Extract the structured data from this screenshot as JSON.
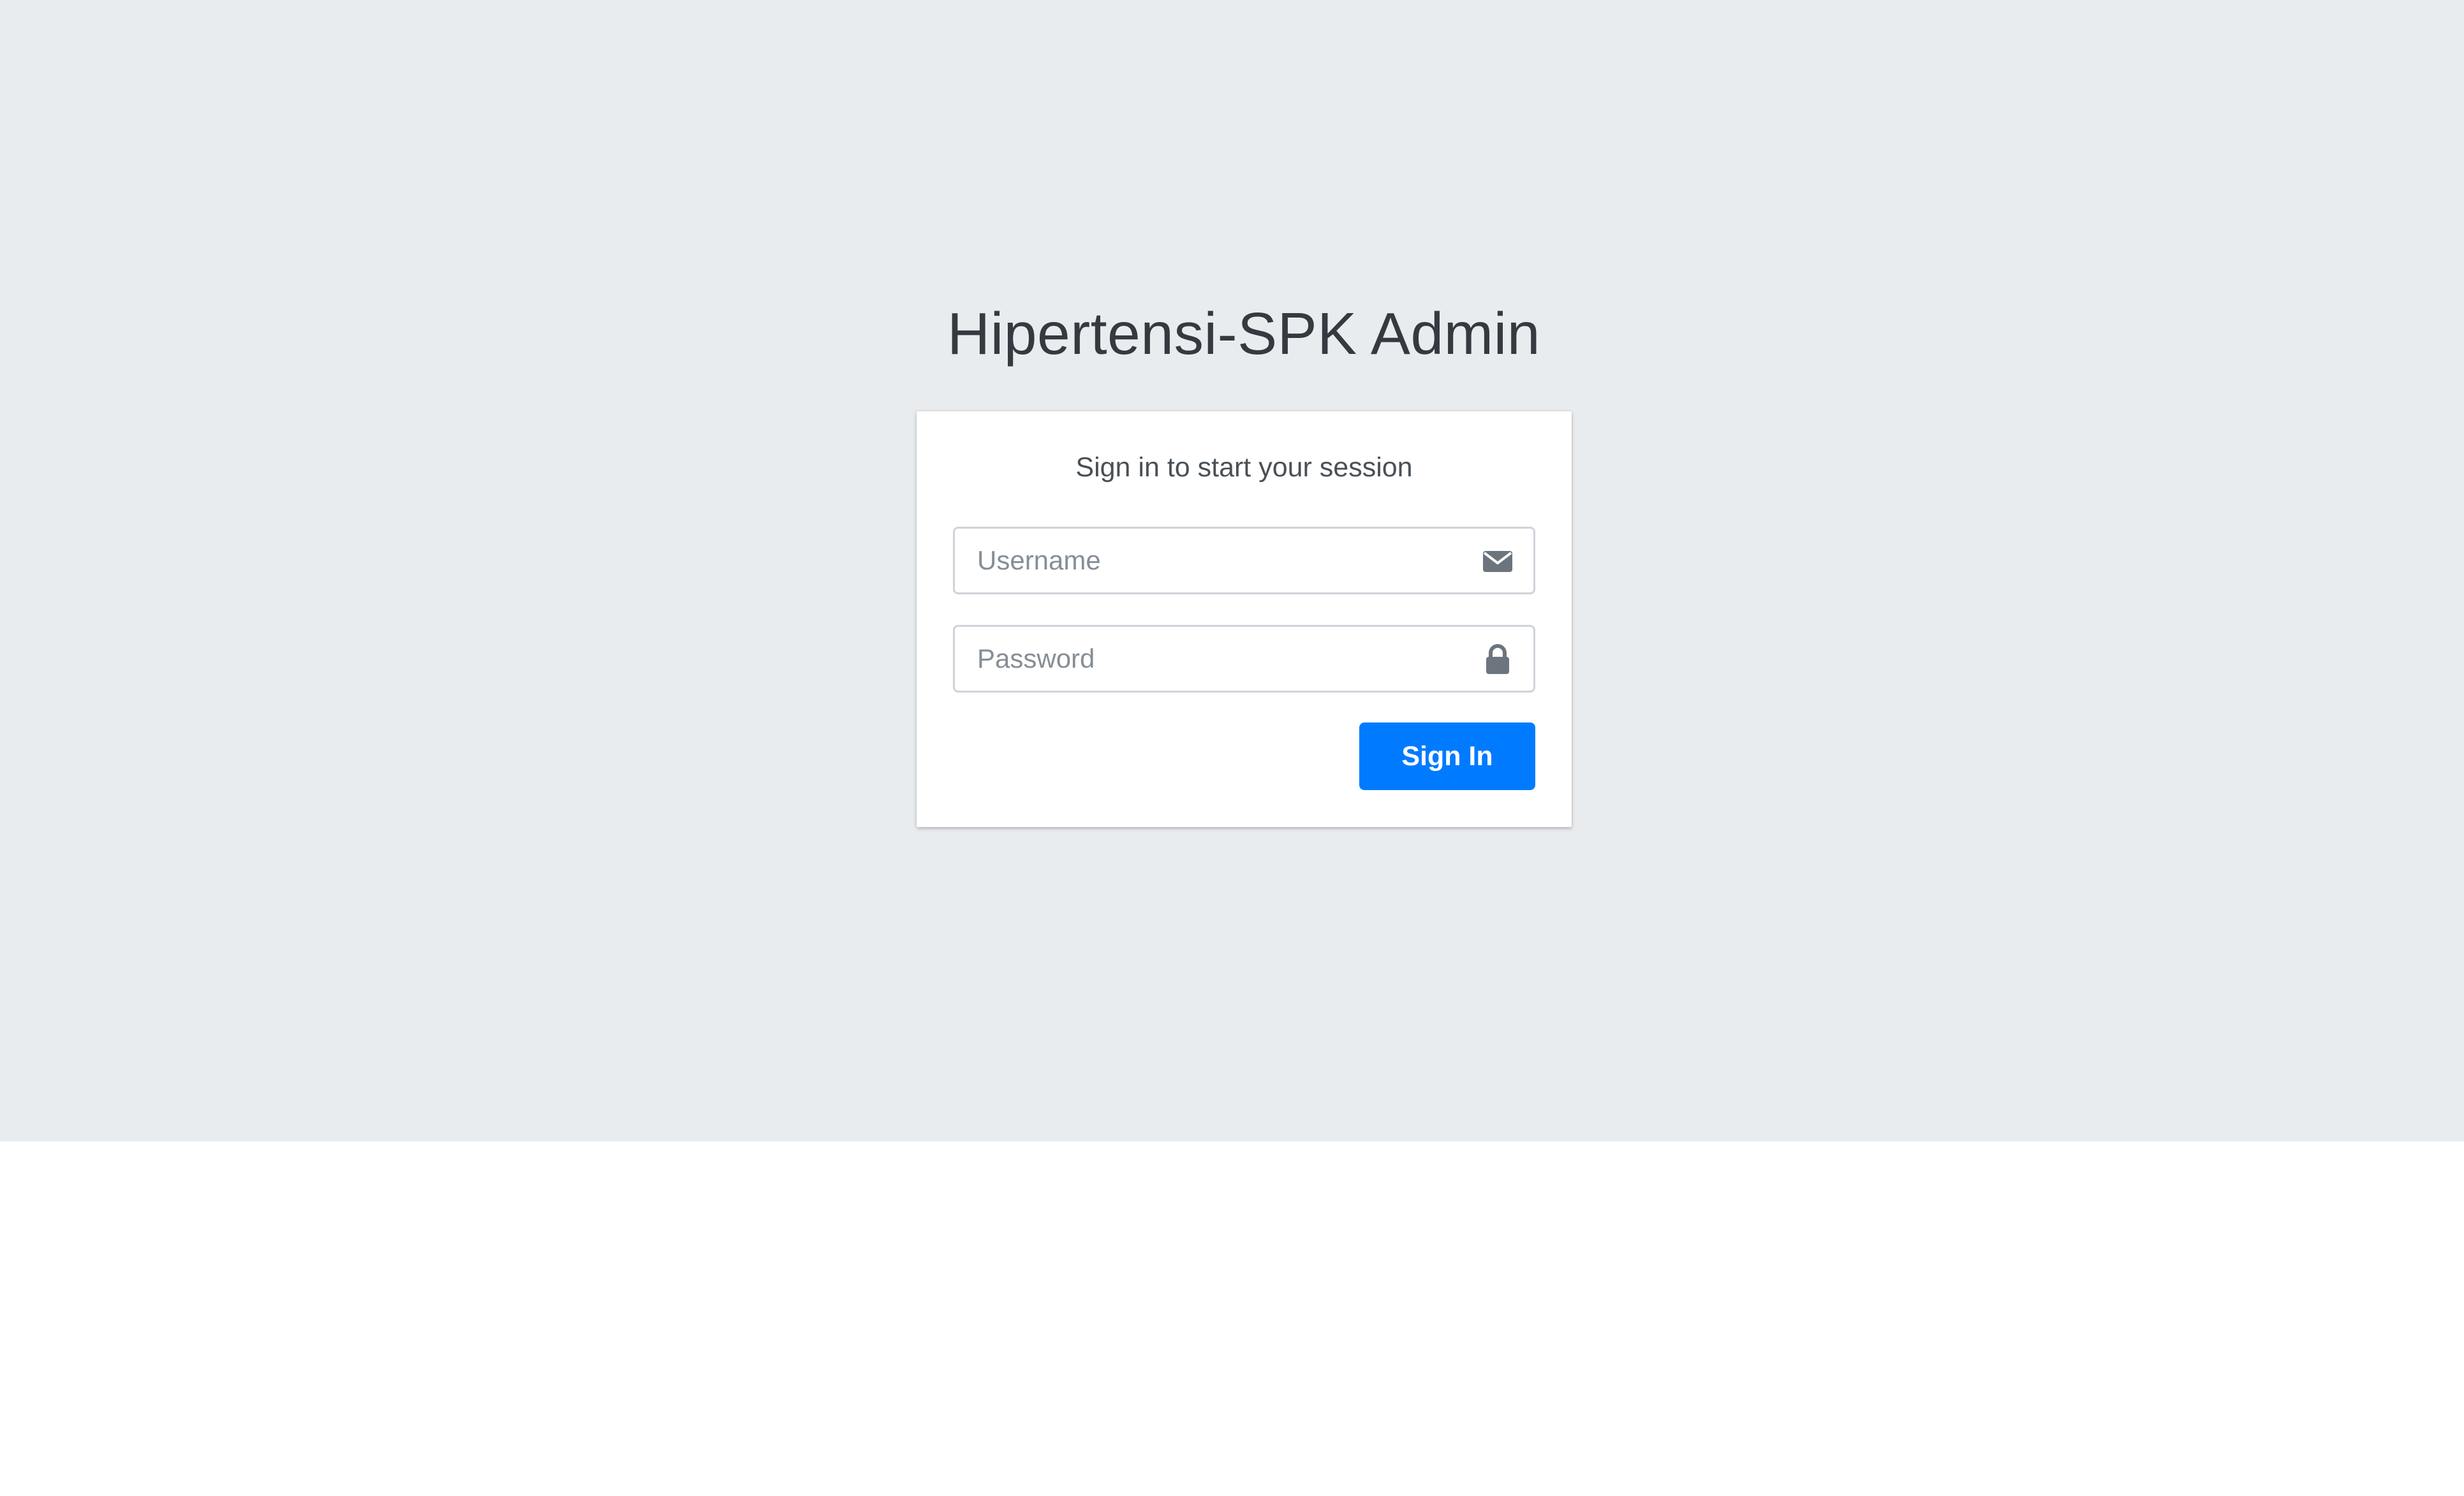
{
  "login": {
    "logo_text": "Hipertensi-SPK Admin",
    "message": "Sign in to start your session",
    "username": {
      "placeholder": "Username",
      "value": "",
      "icon": "envelope-icon"
    },
    "password": {
      "placeholder": "Password",
      "value": "",
      "icon": "lock-icon"
    },
    "submit_label": "Sign In"
  },
  "colors": {
    "page_background": "#e9ecef",
    "card_background": "#ffffff",
    "primary_button": "#007bff",
    "icon": "#6c757d",
    "input_border": "#ced4da",
    "logo_text": "#343a40"
  }
}
